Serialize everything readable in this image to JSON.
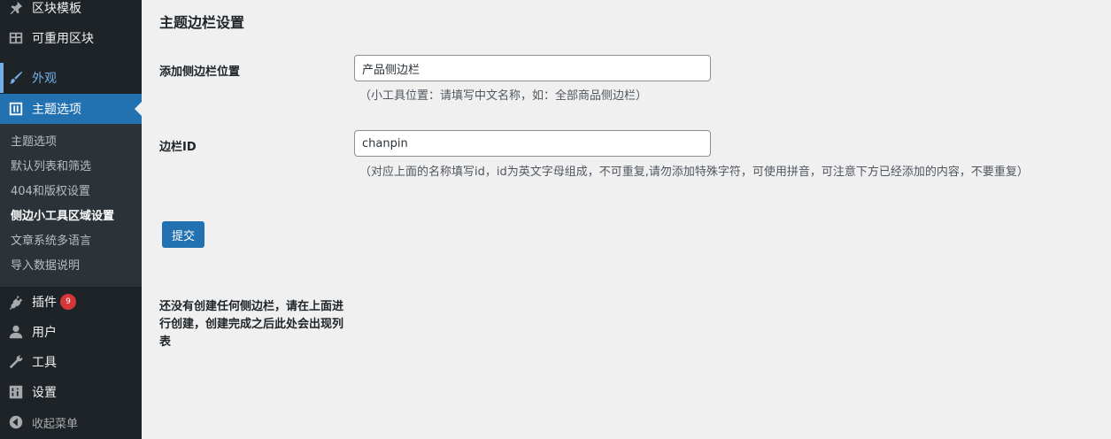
{
  "sidebar": {
    "items": [
      {
        "label": "区块模板",
        "icon": "pin-icon"
      },
      {
        "label": "可重用区块",
        "icon": "table-icon"
      },
      {
        "label": "外观",
        "icon": "brush-icon"
      },
      {
        "label": "主题选项",
        "icon": "theme-options-icon"
      },
      {
        "label": "插件",
        "icon": "plugin-icon",
        "badge": "9"
      },
      {
        "label": "用户",
        "icon": "user-icon"
      },
      {
        "label": "工具",
        "icon": "wrench-icon"
      },
      {
        "label": "设置",
        "icon": "settings-icon"
      },
      {
        "label": "收起菜单",
        "icon": "collapse-icon"
      }
    ],
    "submenu": [
      {
        "label": "主题选项"
      },
      {
        "label": "默认列表和筛选"
      },
      {
        "label": "404和版权设置"
      },
      {
        "label": "侧边小工具区域设置",
        "current": true
      },
      {
        "label": "文章系统多语言"
      },
      {
        "label": "导入数据说明"
      }
    ]
  },
  "main": {
    "title": "主题边栏设置",
    "fields": [
      {
        "label": "添加侧边栏位置",
        "value": "产品侧边栏",
        "description": "（小工具位置：请填写中文名称，如：全部商品侧边栏）"
      },
      {
        "label": "边栏ID",
        "value": "chanpin",
        "description": "（对应上面的名称填写id，id为英文字母组成，不可重复,请勿添加特殊字符，可使用拼音，可注意下方已经添加的内容，不要重复）"
      }
    ],
    "submit_label": "提交",
    "empty_notice": "还没有创建任何侧边栏，请在上面进行创建，创建完成之后此处会出现列表"
  },
  "colors": {
    "sidebar_bg": "#1d2327",
    "submenu_bg": "#2c3338",
    "accent": "#2271b1",
    "page_bg": "#f0f0f1",
    "badge": "#d63638"
  }
}
